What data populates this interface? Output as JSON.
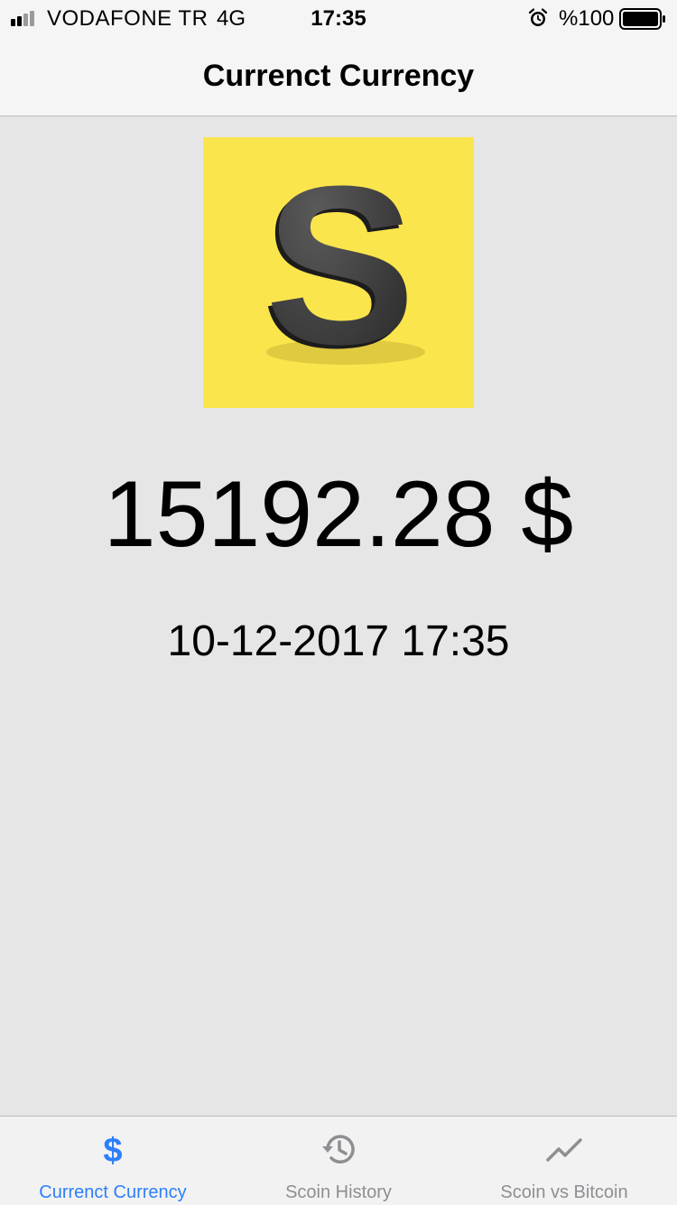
{
  "status_bar": {
    "carrier": "VODAFONE TR",
    "network": "4G",
    "time": "17:35",
    "battery": "%100",
    "icons": [
      "signal-bars-icon",
      "alarm-clock-icon",
      "battery-icon"
    ]
  },
  "nav": {
    "title": "Currenct Currency"
  },
  "logo": {
    "letter": "S",
    "background_color": "#fbe54d",
    "letter_color": "#3a3a3a"
  },
  "main": {
    "price": "15192.28 $",
    "datetime": "10-12-2017 17:35"
  },
  "tab_bar": {
    "active_color": "#2d7ff9",
    "inactive_color": "#8e8e93",
    "tabs": [
      {
        "label": "Currenct Currency",
        "icon": "dollar-icon",
        "active": true
      },
      {
        "label": "Scoin History",
        "icon": "history-icon",
        "active": false
      },
      {
        "label": "Scoin vs Bitcoin",
        "icon": "trend-line-icon",
        "active": false
      }
    ]
  }
}
